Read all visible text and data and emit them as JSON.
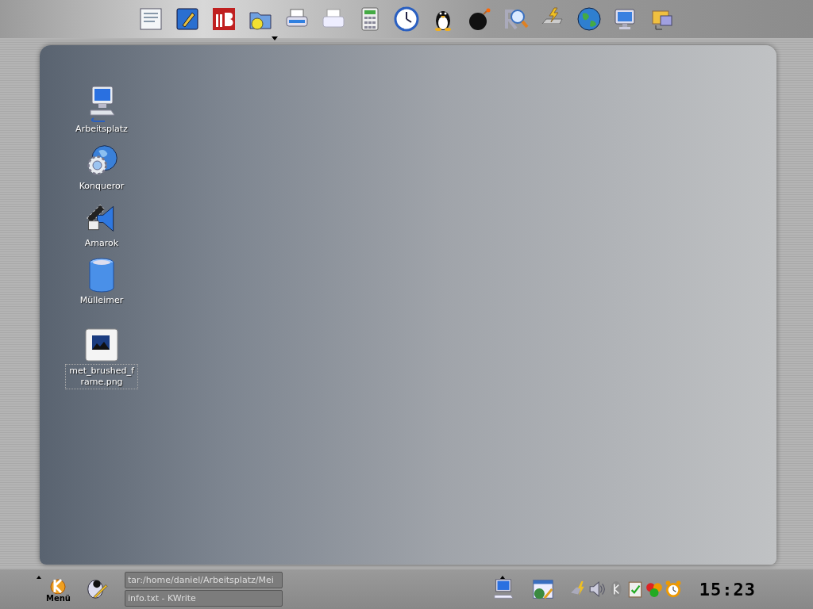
{
  "desktop_icons": [
    {
      "kind": "computer",
      "label": "Arbeitsplatz",
      "selected": false
    },
    {
      "kind": "browser",
      "label": "Konqueror",
      "selected": false
    },
    {
      "kind": "media",
      "label": "Amarok",
      "selected": false
    },
    {
      "kind": "trash",
      "label": "Mülleimer",
      "selected": false
    },
    {
      "kind": "image",
      "label": "met_brushed_frame.png",
      "selected": true
    }
  ],
  "panel": {
    "menu_label": "Menü",
    "tasks": [
      {
        "label": "tar:/home/daniel/Arbeitsplatz/Mei"
      },
      {
        "label": "info.txt - KWrite"
      }
    ],
    "clock": "15:23"
  }
}
